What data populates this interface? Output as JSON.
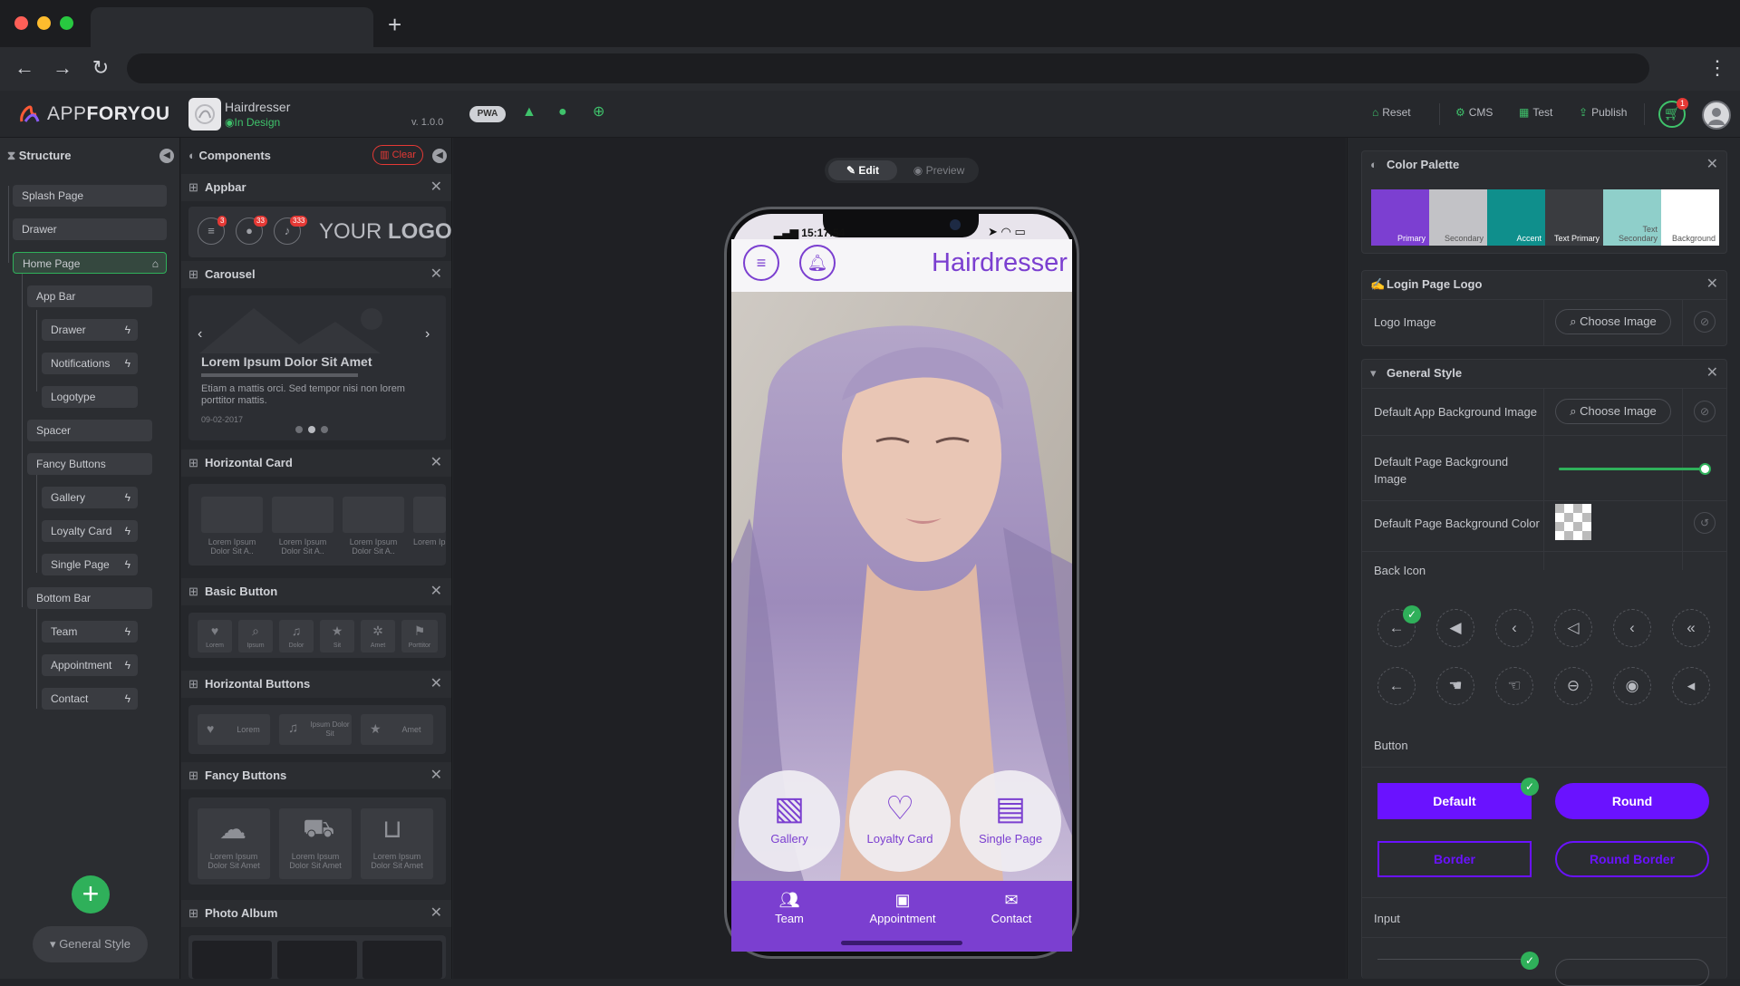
{
  "browser": {
    "new_tab": "+",
    "back": "←",
    "forward": "→",
    "reload": "↻",
    "menu": "⋮"
  },
  "header": {
    "logo_part1": "APP",
    "logo_part2": "FORYOU",
    "project_name": "Hairdresser",
    "project_status": "In Design",
    "version": "v. 1.0.0",
    "pwa_label": "PWA",
    "reset": "Reset",
    "cms": "CMS",
    "test": "Test",
    "publish": "Publish",
    "cart_count": "1"
  },
  "structure": {
    "title": "Structure",
    "items": [
      {
        "label": "Splash Page"
      },
      {
        "label": "Drawer"
      },
      {
        "label": "Home Page"
      },
      {
        "label": "App Bar"
      },
      {
        "label": "Drawer"
      },
      {
        "label": "Notifications"
      },
      {
        "label": "Logotype"
      },
      {
        "label": "Spacer"
      },
      {
        "label": "Fancy Buttons"
      },
      {
        "label": "Gallery"
      },
      {
        "label": "Loyalty Card"
      },
      {
        "label": "Single Page"
      },
      {
        "label": "Bottom Bar"
      },
      {
        "label": "Team"
      },
      {
        "label": "Appointment"
      },
      {
        "label": "Contact"
      }
    ],
    "general_style": "General Style"
  },
  "components": {
    "title": "Components",
    "clear": "Clear",
    "appbar": {
      "title": "Appbar",
      "badges": [
        "3",
        "33",
        "333"
      ],
      "logo_light": "YOUR ",
      "logo_bold": "LOGO"
    },
    "carousel": {
      "title": "Carousel",
      "heading": "Lorem Ipsum Dolor Sit Amet",
      "body": "Etiam a mattis orci. Sed tempor nisi non lorem porttitor mattis.",
      "date": "09-02-2017"
    },
    "horizontal_card": {
      "title": "Horizontal Card",
      "cards": [
        "Lorem Ipsum Dolor Sit A..",
        "Lorem Ipsum Dolor Sit A..",
        "Lorem Ipsum Dolor Sit A..",
        "Lorem Ipsum Dolor S"
      ]
    },
    "basic_button": {
      "title": "Basic Button",
      "labels": [
        "Lorem",
        "Ipsum",
        "Dolor",
        "Sit",
        "Amet",
        "Porttitor"
      ]
    },
    "horizontal_buttons": {
      "title": "Horizontal Buttons",
      "labels": [
        "Lorem",
        "Ipsum Dolor Sit",
        "Amet"
      ]
    },
    "fancy_buttons": {
      "title": "Fancy Buttons",
      "labels": [
        "Lorem Ipsum Dolor Sit Amet",
        "Lorem Ipsum Dolor Sit Amet",
        "Lorem Ipsum Dolor Sit Amet"
      ]
    },
    "photo_album": {
      "title": "Photo Album"
    }
  },
  "canvas": {
    "edit": "Edit",
    "preview": "Preview",
    "phone": {
      "time": "15:17:54",
      "app_title": "Hairdresser",
      "fancy_buttons": [
        {
          "label": "Gallery",
          "icon": "image-icon"
        },
        {
          "label": "Loyalty Card",
          "icon": "heart-icon"
        },
        {
          "label": "Single Page",
          "icon": "page-icon"
        }
      ],
      "bottom_bar": [
        {
          "label": "Team",
          "icon": "users-icon"
        },
        {
          "label": "Appointment",
          "icon": "calendar-icon"
        },
        {
          "label": "Contact",
          "icon": "envelope-icon"
        }
      ]
    }
  },
  "right_panel": {
    "color_palette": {
      "title": "Color Palette",
      "swatches": [
        {
          "label": "Primary",
          "color": "#7c3fd1"
        },
        {
          "label": "Secondary",
          "color": "#c2c2c6"
        },
        {
          "label": "Accent",
          "color": "#0f8f8c"
        },
        {
          "label": "Text Primary",
          "color": "#3a3c40"
        },
        {
          "label": "Text Secondary",
          "color": "#8fcfca"
        },
        {
          "label": "Background",
          "color": "#ffffff"
        }
      ]
    },
    "login_logo": {
      "title": "Login Page Logo",
      "logo_image_label": "Logo Image",
      "choose": "Choose Image"
    },
    "general_style": {
      "title": "General Style",
      "bg_image_label": "Default App Background Image",
      "choose": "Choose Image",
      "page_bg_image_label": "Default Page Background Image",
      "page_bg_image_slider": 1.0,
      "page_bg_color_label": "Default Page Background Color",
      "back_icon_label": "Back Icon",
      "button_label": "Button",
      "buttons": {
        "default": "Default",
        "round": "Round",
        "border": "Border",
        "round_border": "Round Border"
      },
      "input_label": "Input"
    }
  },
  "colors": {
    "primary": "#7b3fd0",
    "button_primary": "#6a12ff",
    "green": "#2fb05a",
    "red": "#e53935"
  }
}
